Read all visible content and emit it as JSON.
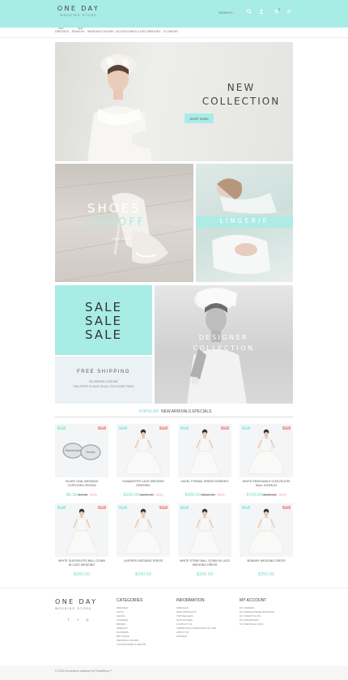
{
  "header": {
    "logo_main": "ONE DAY",
    "logo_sub": "WEDDING STORE",
    "search_placeholder": "SEARCH...",
    "cart_count": "0",
    "accent": "#a8ece6",
    "icons": [
      "search-icon",
      "user-icon",
      "cart-icon",
      "settings-icon"
    ]
  },
  "nav": {
    "new_tags": [
      "NEW",
      "NEW"
    ],
    "items": [
      "Dresses",
      "Jewelry",
      "Wedding Favors",
      "Accessories & Decor",
      "Shoes",
      "Flowers"
    ]
  },
  "hero": {
    "title1": "NEW",
    "title2": "COLLECTION",
    "button": "SHOP NOW!"
  },
  "shoes": {
    "title": "SHOES",
    "discount": "25%OFF",
    "button": "SHOP NOW!"
  },
  "lingerie": {
    "title": "LINGERIE"
  },
  "sale": {
    "lines": [
      "SALE",
      "SALE",
      "SALE"
    ]
  },
  "shipping": {
    "title": "FREE SHIPPING",
    "line1": "ON ORDERS OVER $99.",
    "line2": "THIS OFFER IS VALID ON ALL OUR STORE ITEMS."
  },
  "designer": {
    "line1": "DESIGNER",
    "line2": "COLLECTION"
  },
  "tabs": [
    "POPULAR",
    "NEW ARRIVALS",
    "SPECIALS"
  ],
  "badges": {
    "new": "NEW",
    "sale": "SALE"
  },
  "products": [
    {
      "name": "SILVER OVAL WEDDING CUFFLINKS GROOM",
      "price": "$5.60",
      "old": "$7.00",
      "pct": "-20%",
      "new_badge": true,
      "sale_badge": true,
      "image": "cufflinks"
    },
    {
      "name": "GUNMASTER LACE WEDDING DRESSES",
      "price": "$280.00",
      "old": "$300.00",
      "pct": "-20%",
      "new_badge": true,
      "sale_badge": true,
      "image": "dress"
    },
    {
      "name": "HAZEL FORMAL DRESS WOMEN'S",
      "price": "$400.00",
      "old": "$500.00",
      "pct": "-20%",
      "new_badge": true,
      "sale_badge": true,
      "image": "dress"
    },
    {
      "name": "WHITE REMOVABLE SLEEVELESS BALL GOWN IN",
      "price": "$700.00",
      "old": "$800.00",
      "pct": "-20%",
      "new_badge": true,
      "sale_badge": true,
      "image": "dress"
    },
    {
      "name": "WHITE SLEEVELESS BALL GOWN IN LACE WEDDING",
      "price": "$260.00",
      "old": "",
      "pct": "",
      "new_badge": true,
      "sale_badge": true,
      "image": "dress"
    },
    {
      "name": "LAYERED WEDDING DRESS",
      "price": "$340.00",
      "old": "",
      "pct": "",
      "new_badge": true,
      "sale_badge": true,
      "image": "dress"
    },
    {
      "name": "WHITE STRAP BALL GOWN IN LACE WEDDING DRESS",
      "price": "$330.00",
      "old": "",
      "pct": "",
      "new_badge": true,
      "sale_badge": false,
      "image": "dress"
    },
    {
      "name": "BONNNY WEDDING DRESS",
      "price": "$250.00",
      "old": "",
      "pct": "",
      "new_badge": true,
      "sale_badge": true,
      "image": "dress"
    }
  ],
  "footer": {
    "logo_main": "ONE DAY",
    "logo_sub": "WEDDING STORE",
    "social": [
      "facebook-icon",
      "twitter-icon",
      "pinterest-icon"
    ],
    "social_glyphs": [
      "f",
      "t",
      "p"
    ],
    "columns": [
      {
        "title": "CATEGORIES",
        "links": [
          "DRESSES",
          "GIFTS",
          "SHOES",
          "LINGERIE",
          "BRIDES",
          "JEWELRY",
          "FLOWERS",
          "BOUTIQUE",
          "WEDDING FAVORS",
          "ACCESSORIES & DECOR"
        ]
      },
      {
        "title": "INFORMATION",
        "links": [
          "SPECIALS",
          "NEW PRODUCTS",
          "TOP SELLERS",
          "OUR STORES",
          "CONTACT US",
          "TERMS AND CONDITIONS OF USE",
          "ABOUT US",
          "SITEMAP"
        ]
      },
      {
        "title": "MY ACCOUNT",
        "links": [
          "MY ORDERS",
          "MY MERCHANDISE RETURNS",
          "MY CREDIT SLIPS",
          "MY ADDRESSES",
          "MY PERSONAL INFO"
        ]
      }
    ]
  },
  "copyright": "© 2015 Ecommerce software by PrestaShop™"
}
